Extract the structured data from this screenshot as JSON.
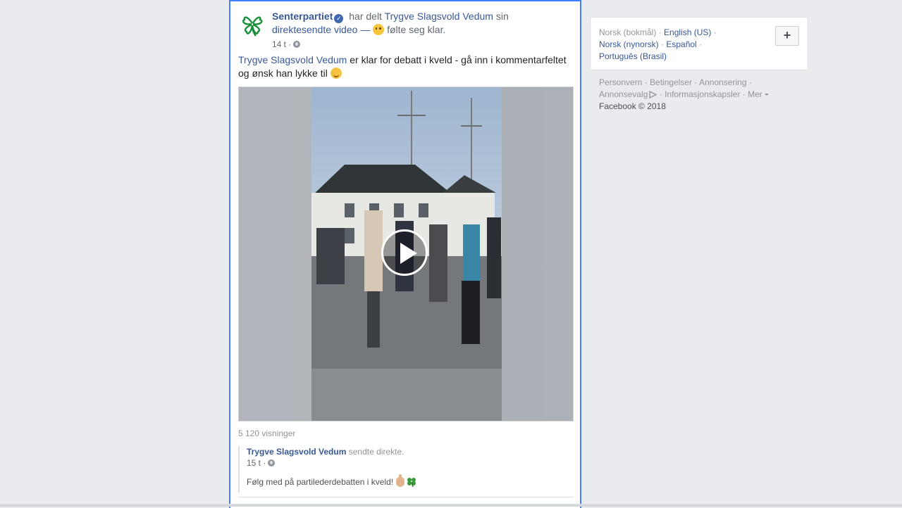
{
  "post": {
    "page_name": "Senterpartiet",
    "shared_prefix": "har delt",
    "shared_person": "Trygve Slagsvold Vedum",
    "shared_suffix": "sin",
    "shared_object": "direktesendte video",
    "dash": "—",
    "feeling": "følte seg klar.",
    "time": "14 t",
    "body_link": "Trygve Slagsvold Vedum",
    "body_text": "er klar for debatt i kveld - gå inn i kommentarfeltet og ønsk han lykke til",
    "views": "5 120 visninger",
    "original": {
      "author": "Trygve Slagsvold Vedum",
      "action": "sendte direkte.",
      "time": "15 t",
      "text": "Følg med på partilederdebatten i kveld!"
    }
  },
  "sidebar": {
    "languages": [
      {
        "label": "Norsk (bokmål)",
        "current": true
      },
      {
        "label": "English (US)"
      },
      {
        "label": "Norsk (nynorsk)"
      },
      {
        "label": "Español"
      },
      {
        "label": "Português (Brasil)"
      }
    ],
    "plus_label": "+",
    "footer": {
      "privacy": "Personvern",
      "terms": "Betingelser",
      "advertising": "Annonsering",
      "ad_choices": "Annonsevalg",
      "cookies": "Informasjonskapsler",
      "more": "Mer",
      "copyright": "Facebook © 2018"
    }
  },
  "colors": {
    "link": "#385898",
    "post_border": "#4080ff",
    "page_bg": "#e9ebee",
    "brand_green": "#1a8f3a"
  },
  "icons": {
    "verified": "verified-badge-icon",
    "privacy": "globe-icon",
    "play": "play-icon",
    "clover": "four-leaf-clover-icon"
  }
}
